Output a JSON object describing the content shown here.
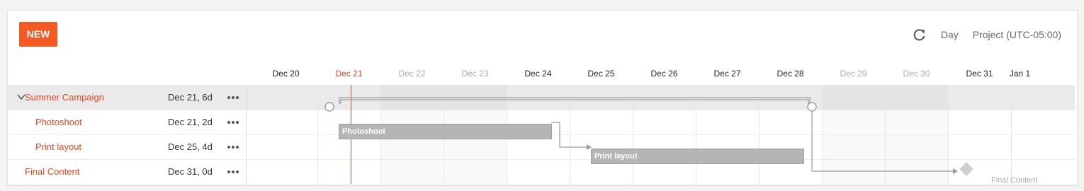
{
  "toolbar": {
    "new_label": "NEW",
    "refresh_icon": "refresh-icon",
    "view_label": "Day",
    "timezone_label": "Project (UTC-05:00)"
  },
  "timeline": {
    "dates": [
      {
        "label": "Dec 20",
        "state": "normal"
      },
      {
        "label": "Dec 21",
        "state": "today"
      },
      {
        "label": "Dec 22",
        "state": "weekend"
      },
      {
        "label": "Dec 23",
        "state": "weekend"
      },
      {
        "label": "Dec 24",
        "state": "normal"
      },
      {
        "label": "Dec 25",
        "state": "normal"
      },
      {
        "label": "Dec 26",
        "state": "normal"
      },
      {
        "label": "Dec 27",
        "state": "normal"
      },
      {
        "label": "Dec 28",
        "state": "normal"
      },
      {
        "label": "Dec 29",
        "state": "weekend"
      },
      {
        "label": "Dec 30",
        "state": "weekend"
      },
      {
        "label": "Dec 31",
        "state": "normal"
      },
      {
        "label": "Jan 1",
        "state": "normal"
      }
    ]
  },
  "tasks": [
    {
      "name": "Summer Campaign",
      "dates": "Dec 21, 6d",
      "type": "summary",
      "more_icon": "more-icon"
    },
    {
      "name": "Photoshoot",
      "dates": "Dec 21, 2d",
      "type": "task",
      "bar_label": "Photoshoot",
      "more_icon": "more-icon"
    },
    {
      "name": "Print layout",
      "dates": "Dec 25, 4d",
      "type": "task",
      "bar_label": "Print layout",
      "more_icon": "more-icon"
    },
    {
      "name": "Final Content",
      "dates": "Dec 31, 0d",
      "type": "milestone",
      "milestone_label": "Final Content",
      "more_icon": "more-icon"
    }
  ],
  "colors": {
    "accent": "#f45a22",
    "today": "#e8461d",
    "bar": "#b5b5b5"
  }
}
